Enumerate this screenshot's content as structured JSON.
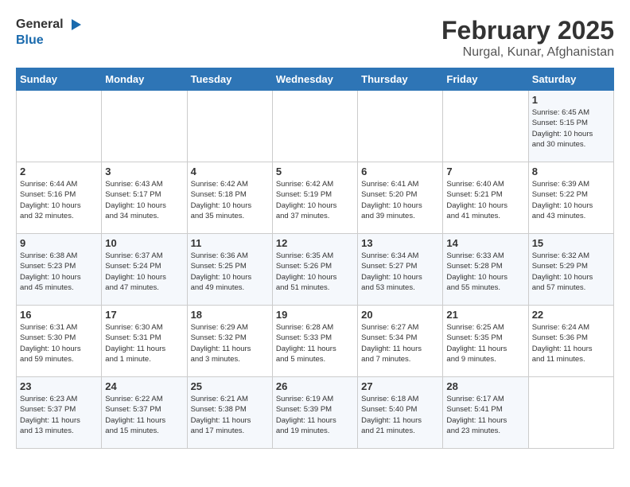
{
  "logo": {
    "general": "General",
    "blue": "Blue"
  },
  "title": "February 2025",
  "subtitle": "Nurgal, Kunar, Afghanistan",
  "days_of_week": [
    "Sunday",
    "Monday",
    "Tuesday",
    "Wednesday",
    "Thursday",
    "Friday",
    "Saturday"
  ],
  "weeks": [
    [
      {
        "day": "",
        "info": ""
      },
      {
        "day": "",
        "info": ""
      },
      {
        "day": "",
        "info": ""
      },
      {
        "day": "",
        "info": ""
      },
      {
        "day": "",
        "info": ""
      },
      {
        "day": "",
        "info": ""
      },
      {
        "day": "1",
        "info": "Sunrise: 6:45 AM\nSunset: 5:15 PM\nDaylight: 10 hours\nand 30 minutes."
      }
    ],
    [
      {
        "day": "2",
        "info": "Sunrise: 6:44 AM\nSunset: 5:16 PM\nDaylight: 10 hours\nand 32 minutes."
      },
      {
        "day": "3",
        "info": "Sunrise: 6:43 AM\nSunset: 5:17 PM\nDaylight: 10 hours\nand 34 minutes."
      },
      {
        "day": "4",
        "info": "Sunrise: 6:42 AM\nSunset: 5:18 PM\nDaylight: 10 hours\nand 35 minutes."
      },
      {
        "day": "5",
        "info": "Sunrise: 6:42 AM\nSunset: 5:19 PM\nDaylight: 10 hours\nand 37 minutes."
      },
      {
        "day": "6",
        "info": "Sunrise: 6:41 AM\nSunset: 5:20 PM\nDaylight: 10 hours\nand 39 minutes."
      },
      {
        "day": "7",
        "info": "Sunrise: 6:40 AM\nSunset: 5:21 PM\nDaylight: 10 hours\nand 41 minutes."
      },
      {
        "day": "8",
        "info": "Sunrise: 6:39 AM\nSunset: 5:22 PM\nDaylight: 10 hours\nand 43 minutes."
      }
    ],
    [
      {
        "day": "9",
        "info": "Sunrise: 6:38 AM\nSunset: 5:23 PM\nDaylight: 10 hours\nand 45 minutes."
      },
      {
        "day": "10",
        "info": "Sunrise: 6:37 AM\nSunset: 5:24 PM\nDaylight: 10 hours\nand 47 minutes."
      },
      {
        "day": "11",
        "info": "Sunrise: 6:36 AM\nSunset: 5:25 PM\nDaylight: 10 hours\nand 49 minutes."
      },
      {
        "day": "12",
        "info": "Sunrise: 6:35 AM\nSunset: 5:26 PM\nDaylight: 10 hours\nand 51 minutes."
      },
      {
        "day": "13",
        "info": "Sunrise: 6:34 AM\nSunset: 5:27 PM\nDaylight: 10 hours\nand 53 minutes."
      },
      {
        "day": "14",
        "info": "Sunrise: 6:33 AM\nSunset: 5:28 PM\nDaylight: 10 hours\nand 55 minutes."
      },
      {
        "day": "15",
        "info": "Sunrise: 6:32 AM\nSunset: 5:29 PM\nDaylight: 10 hours\nand 57 minutes."
      }
    ],
    [
      {
        "day": "16",
        "info": "Sunrise: 6:31 AM\nSunset: 5:30 PM\nDaylight: 10 hours\nand 59 minutes."
      },
      {
        "day": "17",
        "info": "Sunrise: 6:30 AM\nSunset: 5:31 PM\nDaylight: 11 hours\nand 1 minute."
      },
      {
        "day": "18",
        "info": "Sunrise: 6:29 AM\nSunset: 5:32 PM\nDaylight: 11 hours\nand 3 minutes."
      },
      {
        "day": "19",
        "info": "Sunrise: 6:28 AM\nSunset: 5:33 PM\nDaylight: 11 hours\nand 5 minutes."
      },
      {
        "day": "20",
        "info": "Sunrise: 6:27 AM\nSunset: 5:34 PM\nDaylight: 11 hours\nand 7 minutes."
      },
      {
        "day": "21",
        "info": "Sunrise: 6:25 AM\nSunset: 5:35 PM\nDaylight: 11 hours\nand 9 minutes."
      },
      {
        "day": "22",
        "info": "Sunrise: 6:24 AM\nSunset: 5:36 PM\nDaylight: 11 hours\nand 11 minutes."
      }
    ],
    [
      {
        "day": "23",
        "info": "Sunrise: 6:23 AM\nSunset: 5:37 PM\nDaylight: 11 hours\nand 13 minutes."
      },
      {
        "day": "24",
        "info": "Sunrise: 6:22 AM\nSunset: 5:37 PM\nDaylight: 11 hours\nand 15 minutes."
      },
      {
        "day": "25",
        "info": "Sunrise: 6:21 AM\nSunset: 5:38 PM\nDaylight: 11 hours\nand 17 minutes."
      },
      {
        "day": "26",
        "info": "Sunrise: 6:19 AM\nSunset: 5:39 PM\nDaylight: 11 hours\nand 19 minutes."
      },
      {
        "day": "27",
        "info": "Sunrise: 6:18 AM\nSunset: 5:40 PM\nDaylight: 11 hours\nand 21 minutes."
      },
      {
        "day": "28",
        "info": "Sunrise: 6:17 AM\nSunset: 5:41 PM\nDaylight: 11 hours\nand 23 minutes."
      },
      {
        "day": "",
        "info": ""
      }
    ]
  ]
}
